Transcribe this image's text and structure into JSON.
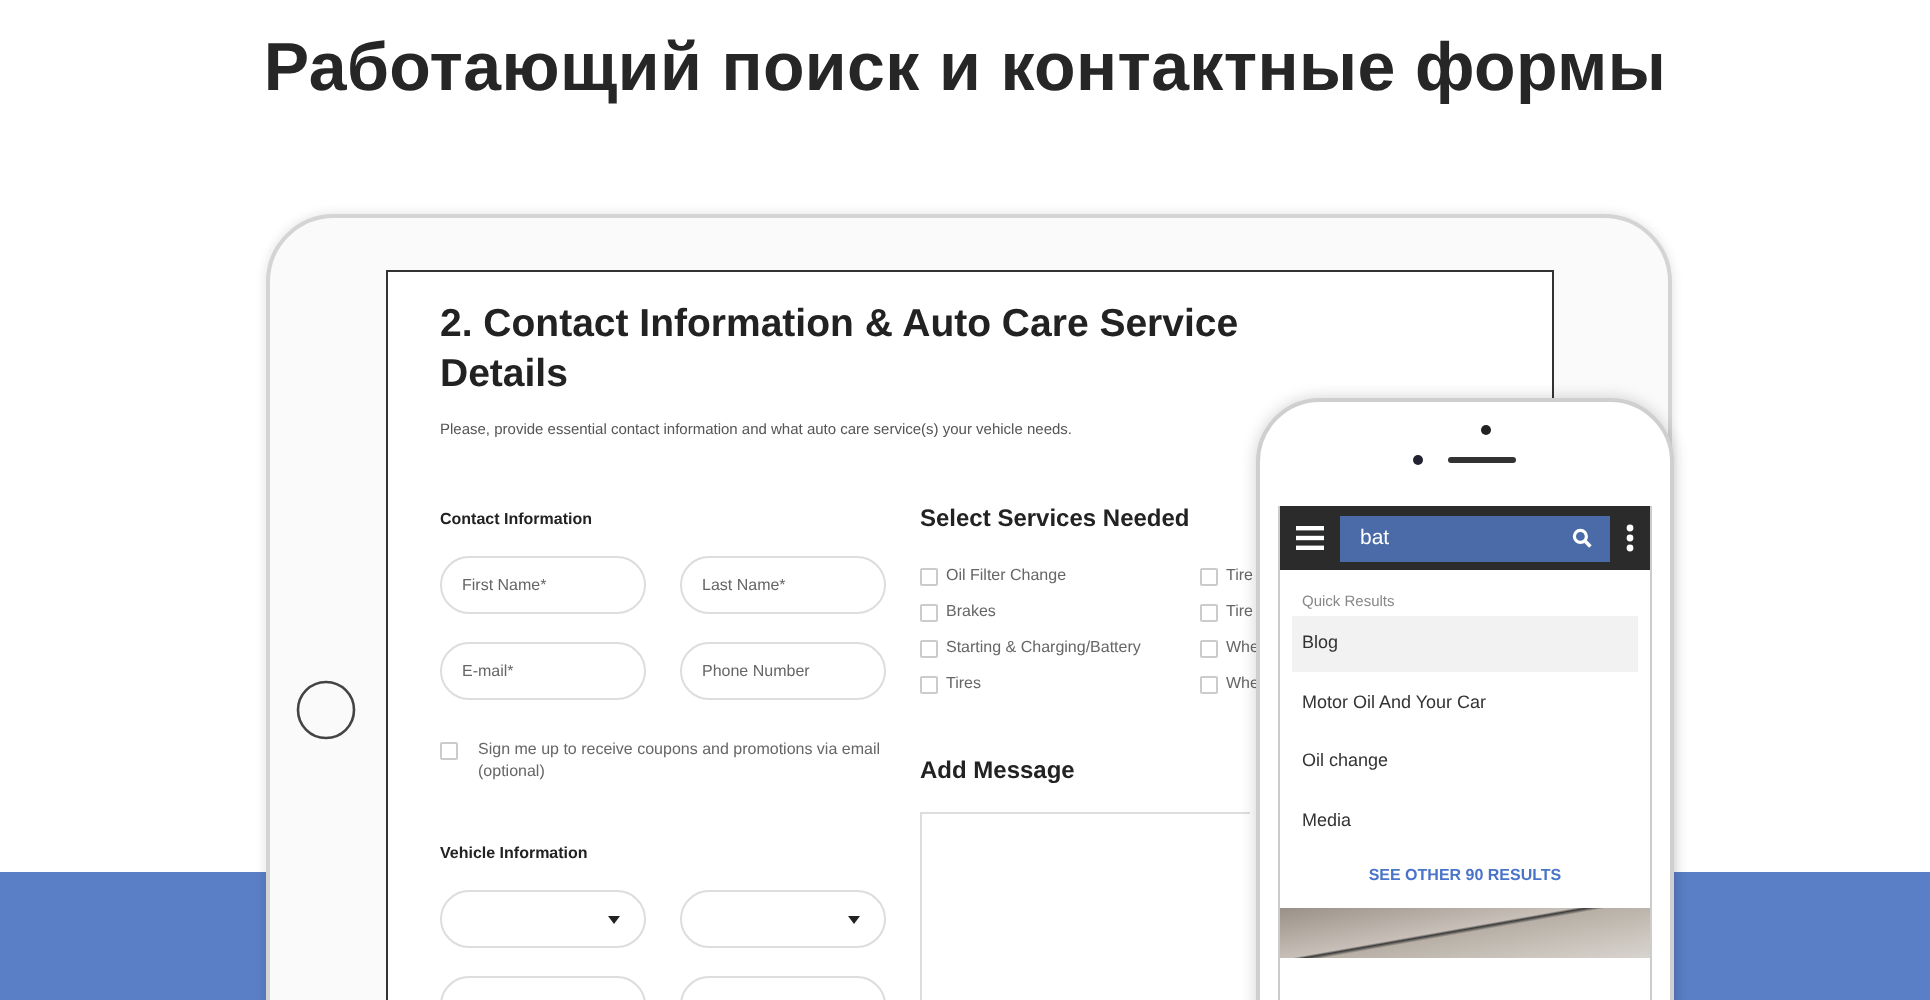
{
  "heading": "Работающий поиск и контактные формы",
  "tablet": {
    "form": {
      "title": "2. Contact Information & Auto Care Service Details",
      "description": "Please, provide essential contact information and what auto care service(s) your vehicle needs.",
      "contact_section": {
        "title": "Contact Information",
        "fields": [
          {
            "placeholder": "First Name*"
          },
          {
            "placeholder": "Last Name*"
          },
          {
            "placeholder": "E-mail*"
          },
          {
            "placeholder": "Phone Number"
          }
        ],
        "newsletter": {
          "label": "Sign me up to receive coupons and promotions via email (optional)",
          "checked": false
        }
      },
      "vehicle_section": {
        "title": "Vehicle Information"
      },
      "services_section": {
        "title": "Select Services Needed",
        "services": [
          {
            "label": "Oil Filter Change",
            "checked": false
          },
          {
            "label": "Tire",
            "checked": false
          },
          {
            "label": "Brakes",
            "checked": false
          },
          {
            "label": "Tire",
            "checked": false
          },
          {
            "label": "Starting & Charging/Battery",
            "checked": false
          },
          {
            "label": "Whe",
            "checked": false
          },
          {
            "label": "Tires",
            "checked": false
          },
          {
            "label": "Whe",
            "checked": false
          }
        ]
      },
      "message_section": {
        "title": "Add Message"
      }
    }
  },
  "phone": {
    "search": {
      "value": "bat"
    },
    "results_heading": "Quick Results",
    "results": [
      {
        "label": "Blog",
        "selected": true
      },
      {
        "label": "Motor Oil And Your Car",
        "selected": false
      },
      {
        "label": "Oil change",
        "selected": false
      },
      {
        "label": "Media",
        "selected": false
      }
    ],
    "more_link": "SEE OTHER 90 RESULTS"
  }
}
